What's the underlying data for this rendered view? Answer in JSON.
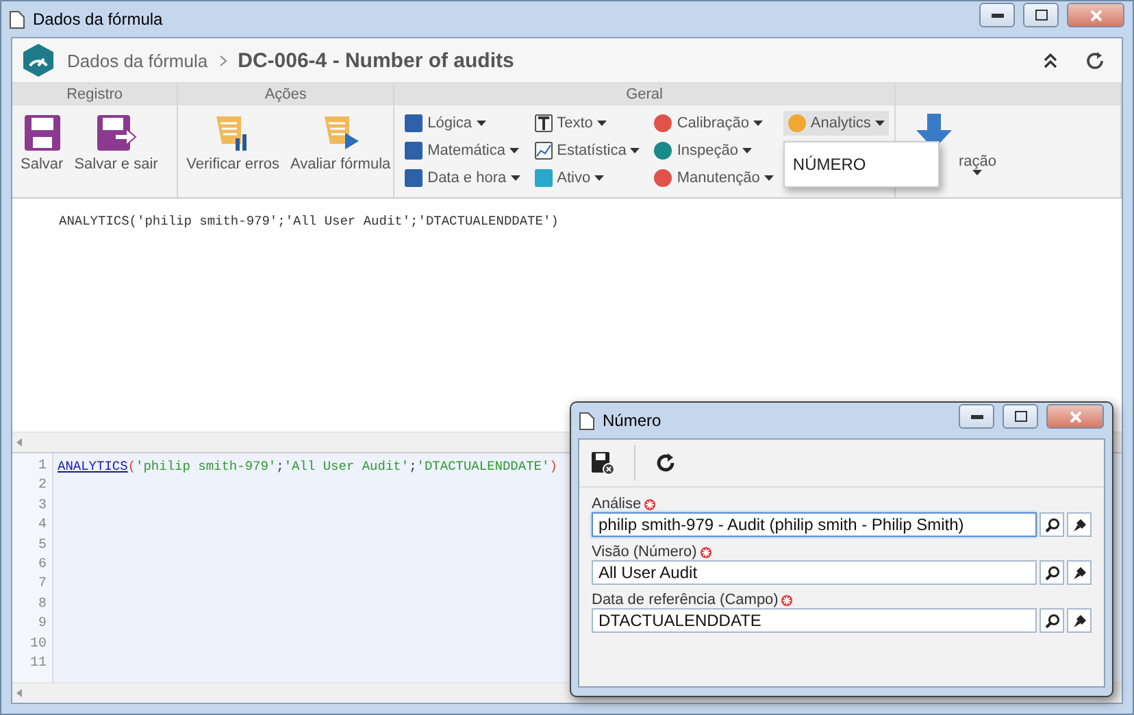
{
  "window": {
    "title": "Dados da fórmula"
  },
  "header": {
    "breadcrumb": "Dados da fórmula",
    "title": "DC-006-4 - Number of audits"
  },
  "ribbon": {
    "groups": [
      {
        "label": "Registro",
        "kind": "buttons",
        "buttons": [
          "Salvar",
          "Salvar e sair"
        ]
      },
      {
        "label": "Ações",
        "kind": "buttons",
        "buttons": [
          "Verificar erros",
          "Avaliar fórmula"
        ]
      },
      {
        "label": "Geral",
        "kind": "menus",
        "columns": [
          [
            {
              "label": "Lógica",
              "expanded": false
            },
            {
              "label": "Matemática",
              "expanded": false
            },
            {
              "label": "Data e hora",
              "expanded": false
            }
          ],
          [
            {
              "label": "Texto",
              "expanded": false
            },
            {
              "label": "Estatística",
              "expanded": false
            },
            {
              "label": "Ativo",
              "expanded": false
            }
          ],
          [
            {
              "label": "Calibração",
              "expanded": false
            },
            {
              "label": "Inspeção",
              "expanded": false
            },
            {
              "label": "Manutenção",
              "expanded": false
            }
          ],
          [
            {
              "label": "Analytics",
              "expanded": true,
              "menu": [
                "NÚMERO"
              ]
            }
          ]
        ]
      },
      {
        "kind": "partial",
        "buttons": [
          "ração"
        ]
      }
    ]
  },
  "formula_text": "ANALYTICS('philip smith-979';'All User Audit';'DTACTUALENDDATE')",
  "code_editor": {
    "lines": [
      {
        "number": "1",
        "tokens": [
          {
            "kind": "function",
            "text": "ANALYTICS"
          },
          {
            "kind": "paren",
            "text": "("
          },
          {
            "kind": "string",
            "text": "'philip smith-979'"
          },
          {
            "kind": "plain",
            "text": ";"
          },
          {
            "kind": "string",
            "text": "'All User Audit'"
          },
          {
            "kind": "plain",
            "text": ";"
          },
          {
            "kind": "string",
            "text": "'DTACTUALENDDATE'"
          },
          {
            "kind": "paren",
            "text": ")"
          }
        ]
      },
      {
        "number": "2"
      },
      {
        "number": "3"
      },
      {
        "number": "4"
      },
      {
        "number": "5"
      },
      {
        "number": "6"
      },
      {
        "number": "7"
      },
      {
        "number": "8"
      },
      {
        "number": "9"
      },
      {
        "number": "10"
      },
      {
        "number": "11"
      }
    ]
  },
  "dialog": {
    "title": "Número",
    "fields": [
      {
        "label": "Análise",
        "required": true,
        "value": "philip smith-979 - Audit (philip smith - Philip Smith)",
        "focused": true
      },
      {
        "label": "Visão (Número)",
        "required": true,
        "value": "All User Audit",
        "focused": false
      },
      {
        "label": "Data de referência (Campo)",
        "required": true,
        "value": "DTACTUALENDDATE",
        "focused": false
      }
    ]
  }
}
